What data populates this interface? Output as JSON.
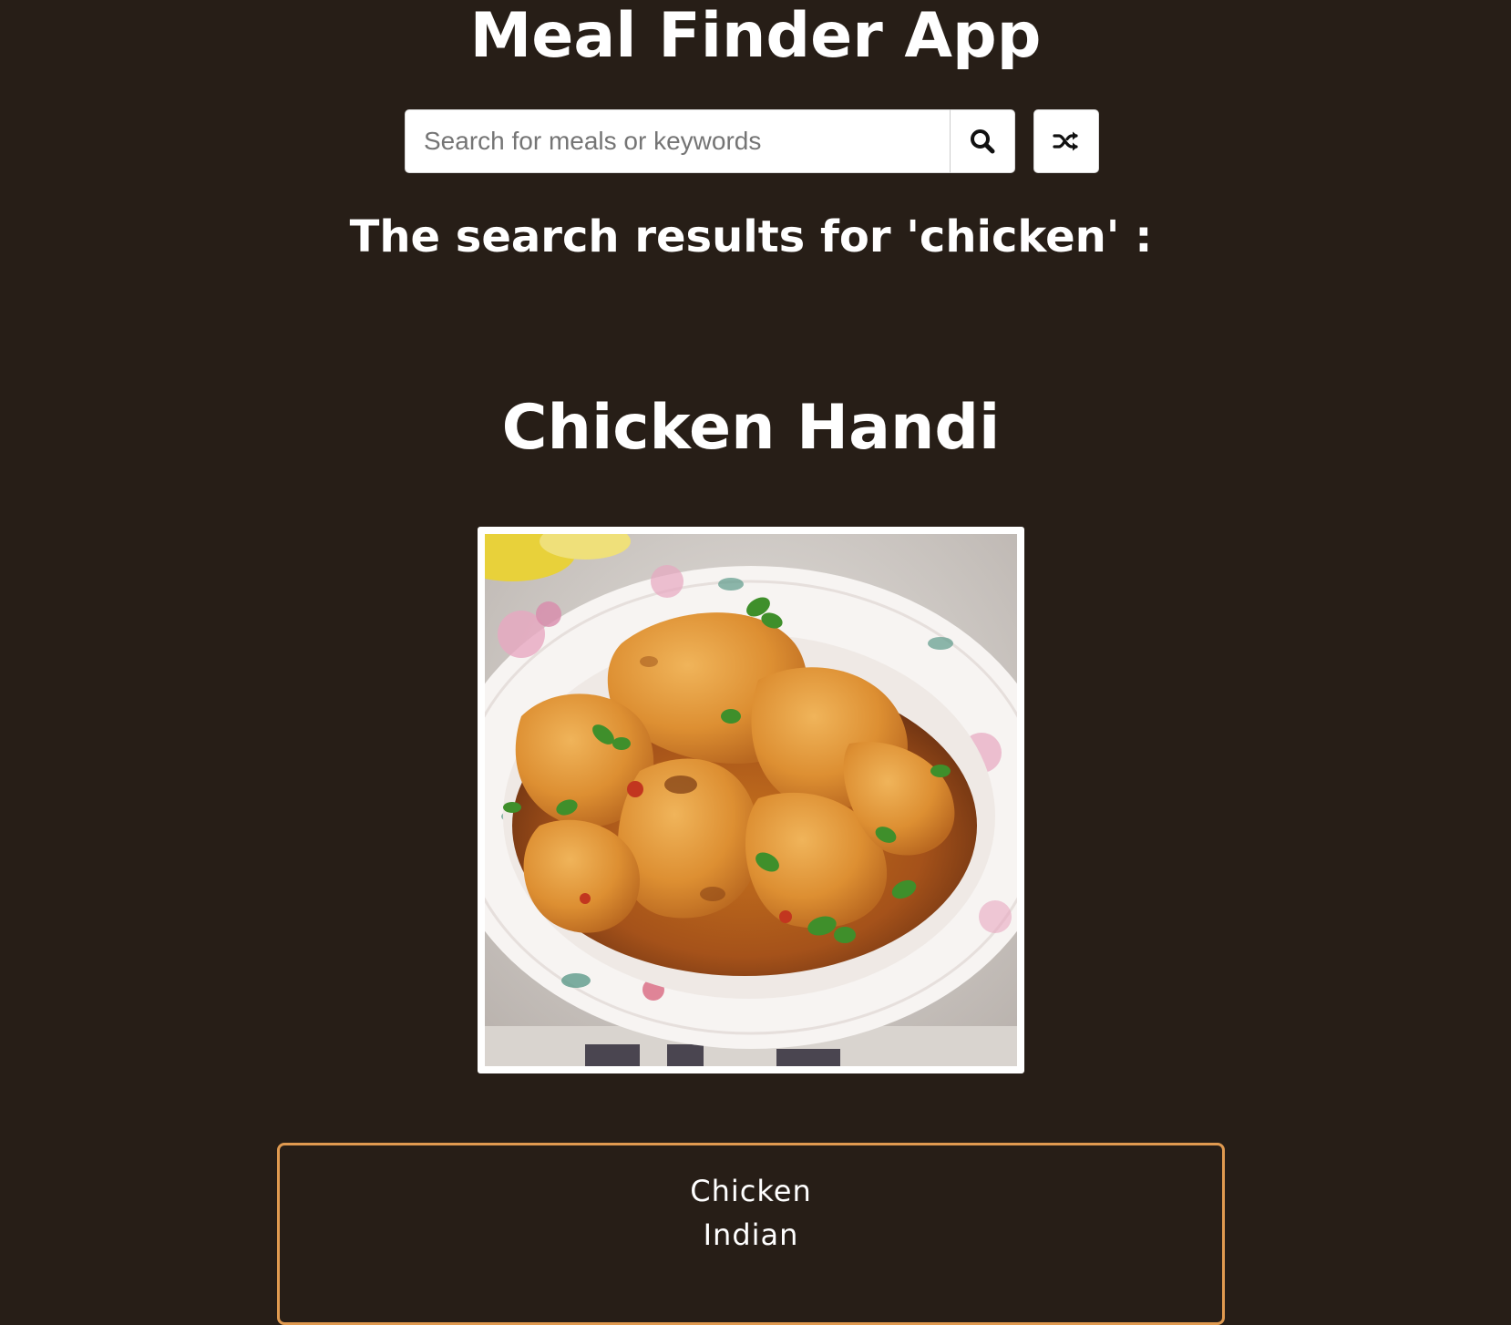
{
  "header": {
    "title": "Meal Finder App"
  },
  "search": {
    "placeholder": "Search for meals or keywords",
    "value": ""
  },
  "icons": {
    "search": "search-icon",
    "random": "shuffle-icon"
  },
  "results": {
    "heading": "The search results for 'chicken' :"
  },
  "meal": {
    "title": "Chicken Handi",
    "category": "Chicken",
    "area": "Indian"
  },
  "colors": {
    "background": "#271e17",
    "info_border": "#e09a50",
    "text": "#ffffff"
  }
}
